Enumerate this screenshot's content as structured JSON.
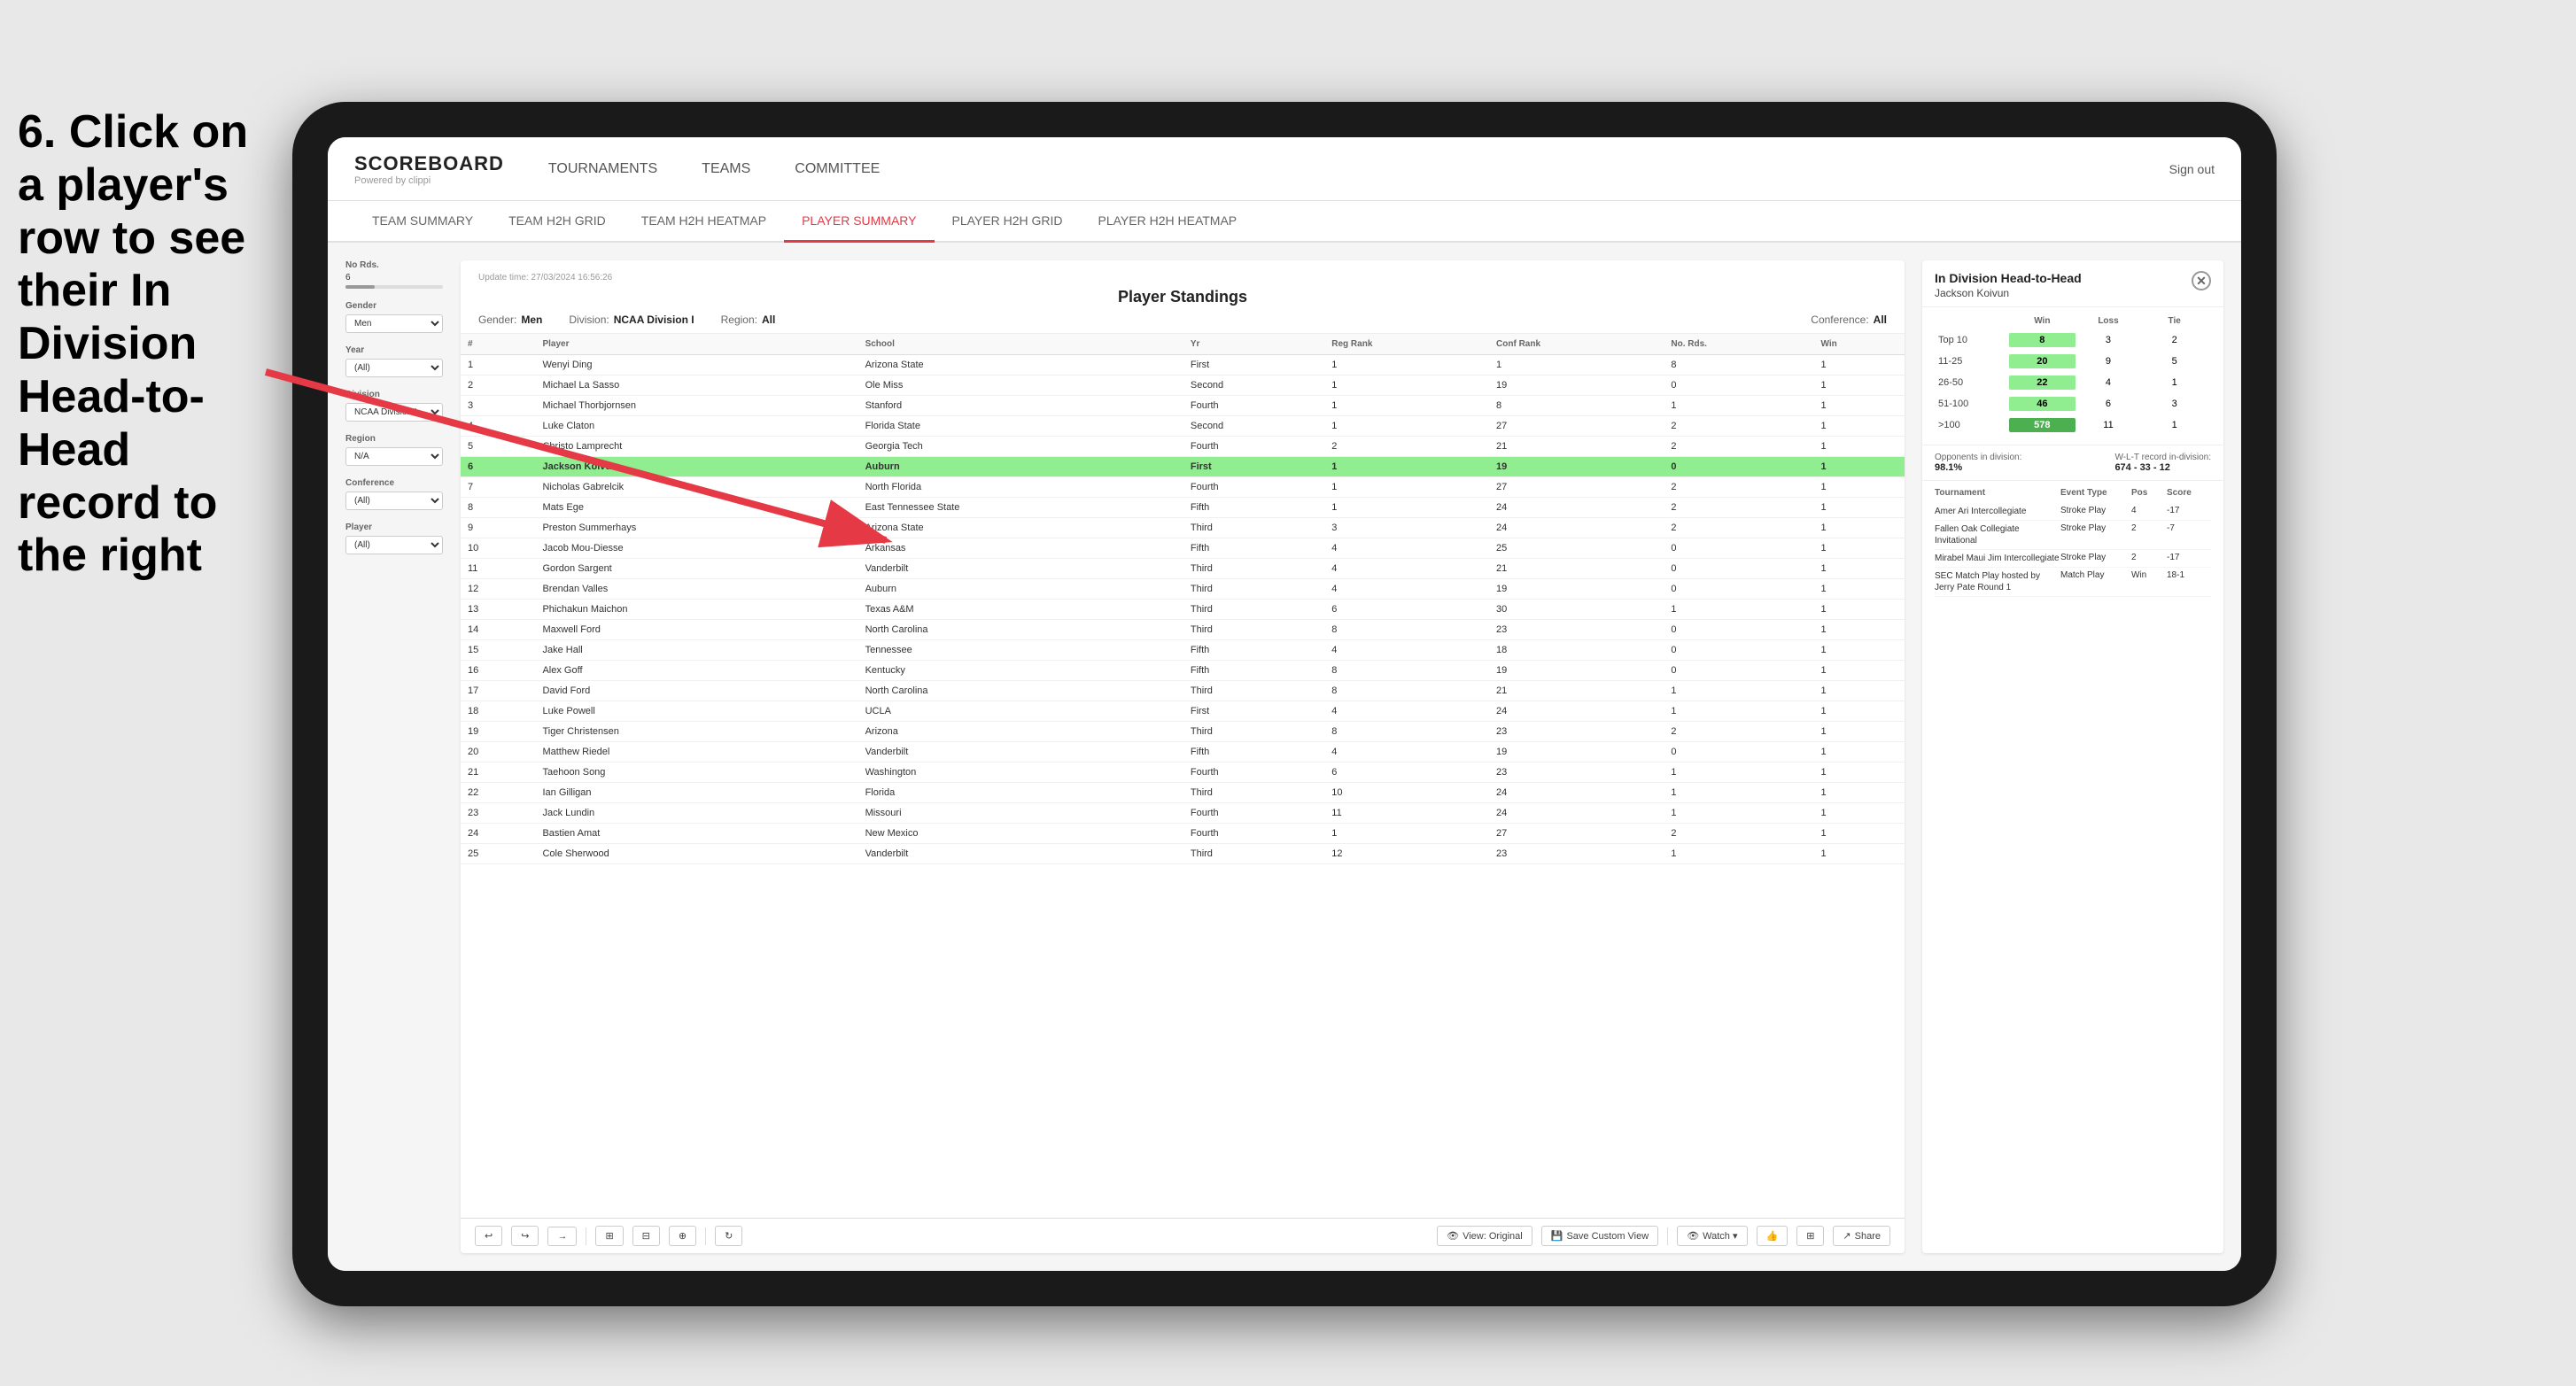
{
  "instruction": {
    "text": "6. Click on a player's row to see their In Division Head-to-Head record to the right"
  },
  "nav": {
    "logo": "SCOREBOARD",
    "logo_sub": "Powered by clippi",
    "items": [
      "TOURNAMENTS",
      "TEAMS",
      "COMMITTEE"
    ],
    "sign_out": "Sign out"
  },
  "sub_nav": {
    "items": [
      "TEAM SUMMARY",
      "TEAM H2H GRID",
      "TEAM H2H HEATMAP",
      "PLAYER SUMMARY",
      "PLAYER H2H GRID",
      "PLAYER H2H HEATMAP"
    ],
    "active": "PLAYER SUMMARY"
  },
  "standings": {
    "title": "Player Standings",
    "update_time": "Update time: 27/03/2024 16:56:26",
    "filters": {
      "gender_label": "Gender:",
      "gender_value": "Men",
      "division_label": "Division:",
      "division_value": "NCAA Division I",
      "region_label": "Region:",
      "region_value": "All",
      "conference_label": "Conference:",
      "conference_value": "All"
    },
    "columns": [
      "#",
      "Player",
      "School",
      "Yr",
      "Reg Rank",
      "Conf Rank",
      "No. Rds.",
      "Win"
    ],
    "rows": [
      {
        "rank": 1,
        "player": "Wenyi Ding",
        "school": "Arizona State",
        "yr": "First",
        "reg": 1,
        "conf": 1,
        "rds": 8,
        "win": 1,
        "highlighted": false
      },
      {
        "rank": 2,
        "player": "Michael La Sasso",
        "school": "Ole Miss",
        "yr": "Second",
        "reg": 1,
        "conf": 19,
        "rds": 0,
        "win": 1,
        "highlighted": false
      },
      {
        "rank": 3,
        "player": "Michael Thorbjornsen",
        "school": "Stanford",
        "yr": "Fourth",
        "reg": 1,
        "conf": 8,
        "rds": 1,
        "win": 1,
        "highlighted": false
      },
      {
        "rank": 4,
        "player": "Luke Claton",
        "school": "Florida State",
        "yr": "Second",
        "reg": 1,
        "conf": 27,
        "rds": 2,
        "win": 1,
        "highlighted": false
      },
      {
        "rank": 5,
        "player": "Christo Lamprecht",
        "school": "Georgia Tech",
        "yr": "Fourth",
        "reg": 2,
        "conf": 21,
        "rds": 2,
        "win": 1,
        "highlighted": false
      },
      {
        "rank": 6,
        "player": "Jackson Koivun",
        "school": "Auburn",
        "yr": "First",
        "reg": 1,
        "conf": 19,
        "rds": 0,
        "win": 1,
        "highlighted": true
      },
      {
        "rank": 7,
        "player": "Nicholas Gabrelcik",
        "school": "North Florida",
        "yr": "Fourth",
        "reg": 1,
        "conf": 27,
        "rds": 2,
        "win": 1,
        "highlighted": false
      },
      {
        "rank": 8,
        "player": "Mats Ege",
        "school": "East Tennessee State",
        "yr": "Fifth",
        "reg": 1,
        "conf": 24,
        "rds": 2,
        "win": 1,
        "highlighted": false
      },
      {
        "rank": 9,
        "player": "Preston Summerhays",
        "school": "Arizona State",
        "yr": "Third",
        "reg": 3,
        "conf": 24,
        "rds": 2,
        "win": 1,
        "highlighted": false
      },
      {
        "rank": 10,
        "player": "Jacob Mou-Diesse",
        "school": "Arkansas",
        "yr": "Fifth",
        "reg": 4,
        "conf": 25,
        "rds": 0,
        "win": 1,
        "highlighted": false
      },
      {
        "rank": 11,
        "player": "Gordon Sargent",
        "school": "Vanderbilt",
        "yr": "Third",
        "reg": 4,
        "conf": 21,
        "rds": 0,
        "win": 1,
        "highlighted": false
      },
      {
        "rank": 12,
        "player": "Brendan Valles",
        "school": "Auburn",
        "yr": "Third",
        "reg": 4,
        "conf": 19,
        "rds": 0,
        "win": 1,
        "highlighted": false
      },
      {
        "rank": 13,
        "player": "Phichakun Maichon",
        "school": "Texas A&M",
        "yr": "Third",
        "reg": 6,
        "conf": 30,
        "rds": 1,
        "win": 1,
        "highlighted": false
      },
      {
        "rank": 14,
        "player": "Maxwell Ford",
        "school": "North Carolina",
        "yr": "Third",
        "reg": 8,
        "conf": 23,
        "rds": 0,
        "win": 1,
        "highlighted": false
      },
      {
        "rank": 15,
        "player": "Jake Hall",
        "school": "Tennessee",
        "yr": "Fifth",
        "reg": 4,
        "conf": 18,
        "rds": 0,
        "win": 1,
        "highlighted": false
      },
      {
        "rank": 16,
        "player": "Alex Goff",
        "school": "Kentucky",
        "yr": "Fifth",
        "reg": 8,
        "conf": 19,
        "rds": 0,
        "win": 1,
        "highlighted": false
      },
      {
        "rank": 17,
        "player": "David Ford",
        "school": "North Carolina",
        "yr": "Third",
        "reg": 8,
        "conf": 21,
        "rds": 1,
        "win": 1,
        "highlighted": false
      },
      {
        "rank": 18,
        "player": "Luke Powell",
        "school": "UCLA",
        "yr": "First",
        "reg": 4,
        "conf": 24,
        "rds": 1,
        "win": 1,
        "highlighted": false
      },
      {
        "rank": 19,
        "player": "Tiger Christensen",
        "school": "Arizona",
        "yr": "Third",
        "reg": 8,
        "conf": 23,
        "rds": 2,
        "win": 1,
        "highlighted": false
      },
      {
        "rank": 20,
        "player": "Matthew Riedel",
        "school": "Vanderbilt",
        "yr": "Fifth",
        "reg": 4,
        "conf": 19,
        "rds": 0,
        "win": 1,
        "highlighted": false
      },
      {
        "rank": 21,
        "player": "Taehoon Song",
        "school": "Washington",
        "yr": "Fourth",
        "reg": 6,
        "conf": 23,
        "rds": 1,
        "win": 1,
        "highlighted": false
      },
      {
        "rank": 22,
        "player": "Ian Gilligan",
        "school": "Florida",
        "yr": "Third",
        "reg": 10,
        "conf": 24,
        "rds": 1,
        "win": 1,
        "highlighted": false
      },
      {
        "rank": 23,
        "player": "Jack Lundin",
        "school": "Missouri",
        "yr": "Fourth",
        "reg": 11,
        "conf": 24,
        "rds": 1,
        "win": 1,
        "highlighted": false
      },
      {
        "rank": 24,
        "player": "Bastien Amat",
        "school": "New Mexico",
        "yr": "Fourth",
        "reg": 1,
        "conf": 27,
        "rds": 2,
        "win": 1,
        "highlighted": false
      },
      {
        "rank": 25,
        "player": "Cole Sherwood",
        "school": "Vanderbilt",
        "yr": "Third",
        "reg": 12,
        "conf": 23,
        "rds": 1,
        "win": 1,
        "highlighted": false
      }
    ]
  },
  "filters": {
    "no_rds_label": "No Rds.",
    "no_rds_value": "6",
    "gender_label": "Gender",
    "gender_value": "Men",
    "year_label": "Year",
    "year_value": "(All)",
    "division_label": "Division",
    "division_value": "NCAA Division I",
    "region_label": "Region",
    "region_value": "N/A",
    "conference_label": "Conference",
    "conference_value": "(All)",
    "player_label": "Player",
    "player_value": "(All)"
  },
  "h2h": {
    "title": "In Division Head-to-Head",
    "player": "Jackson Koivun",
    "col_win": "Win",
    "col_loss": "Loss",
    "col_tie": "Tie",
    "rows": [
      {
        "label": "Top 10",
        "win": 8,
        "loss": 3,
        "tie": 2,
        "win_class": "win-green"
      },
      {
        "label": "11-25",
        "win": 20,
        "loss": 9,
        "tie": 5,
        "win_class": "win-green"
      },
      {
        "label": "26-50",
        "win": 22,
        "loss": 4,
        "tie": 1,
        "win_class": "win-green"
      },
      {
        "label": "51-100",
        "win": 46,
        "loss": 6,
        "tie": 3,
        "win_class": "win-green"
      },
      {
        "label": ">100",
        "win": 578,
        "loss": 11,
        "tie": 1,
        "win_class": "win-bright"
      }
    ],
    "opponents_label": "Opponents in division:",
    "opponents_value": "98.1%",
    "record_label": "W-L-T record in-division:",
    "record_value": "674 - 33 - 12",
    "tournaments_columns": [
      "Tournament",
      "Event Type",
      "Pos",
      "Score"
    ],
    "tournaments": [
      {
        "name": "Amer Ari Intercollegiate",
        "type": "Stroke Play",
        "pos": 4,
        "score": "-17"
      },
      {
        "name": "Fallen Oak Collegiate Invitational",
        "type": "Stroke Play",
        "pos": 2,
        "score": "-7"
      },
      {
        "name": "Mirabel Maui Jim Intercollegiate",
        "type": "Stroke Play",
        "pos": 2,
        "score": "-17"
      },
      {
        "name": "SEC Match Play hosted by Jerry Pate Round 1",
        "type": "Match Play",
        "pos": "Win",
        "score": "18-1"
      }
    ]
  },
  "toolbar": {
    "undo": "↩",
    "redo": "↪",
    "forward": "→",
    "view_original": "View: Original",
    "save_custom": "Save Custom View",
    "watch": "Watch ▾",
    "share": "Share"
  }
}
